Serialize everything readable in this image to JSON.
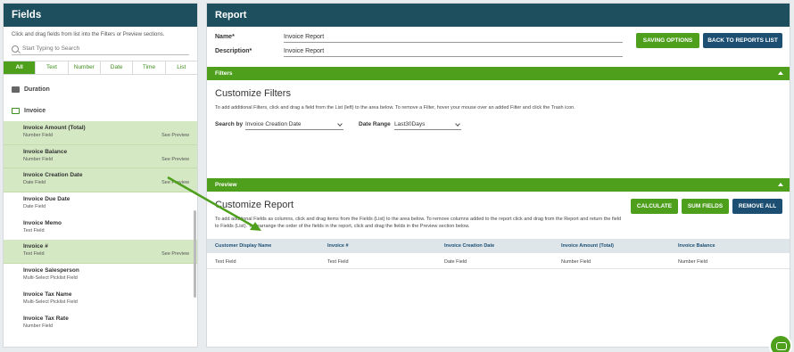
{
  "fields_panel": {
    "title": "Fields",
    "description": "Click and drag fields from list into the Filters or Preview sections.",
    "search_placeholder": "Start Typing to Search",
    "tabs": [
      "All",
      "Text",
      "Number",
      "Date",
      "Time",
      "List"
    ],
    "active_tab": "All",
    "folders": [
      {
        "name": "Duration",
        "state": "closed"
      },
      {
        "name": "Invoice",
        "state": "open"
      }
    ],
    "fields": [
      {
        "name": "Invoice Amount (Total)",
        "type": "Number Field",
        "preview": "See Preview",
        "selected": true
      },
      {
        "name": "Invoice Balance",
        "type": "Number Field",
        "preview": "See Preview",
        "selected": true
      },
      {
        "name": "Invoice Creation Date",
        "type": "Date Field",
        "preview": "See Preview",
        "selected": true
      },
      {
        "name": "Invoice Due Date",
        "type": "Date Field",
        "preview": "",
        "selected": false
      },
      {
        "name": "Invoice Memo",
        "type": "Text Field",
        "preview": "",
        "selected": false
      },
      {
        "name": "Invoice #",
        "type": "Text Field",
        "preview": "See Preview",
        "selected": true
      },
      {
        "name": "Invoice Salesperson",
        "type": "Multi-Select Picklist Field",
        "preview": "",
        "selected": false
      },
      {
        "name": "Invoice Tax Name",
        "type": "Multi-Select Picklist Field",
        "preview": "",
        "selected": false
      },
      {
        "name": "Invoice Tax Rate",
        "type": "Number Field",
        "preview": "",
        "selected": false
      }
    ]
  },
  "report": {
    "title": "Report",
    "name_label": "Name*",
    "name_value": "Invoice Report",
    "description_label": "Description*",
    "description_value": "Invoice Report",
    "saving_options_label": "SAVING OPTIONS",
    "back_label": "BACK TO REPORTS LIST"
  },
  "filters": {
    "bar_label": "Filters",
    "title": "Customize Filters",
    "description": "To add additional Filters, click and drag a field from the List (left) to the area below. To remove a Filter, hover your mouse over an added Filter and click the Trash icon.",
    "search_by_label": "Search by",
    "search_by_value": "Invoice Creation Date",
    "date_range_label": "Date Range",
    "date_range_value": "Last30Days"
  },
  "preview": {
    "bar_label": "Preview",
    "title": "Customize Report",
    "description": "To add additional Fields as columns, click and drag items from the Fields (List) to the area below. To remove columns added to the report click and drag from the Report and return the field to Fields (List). To rearrange the order of the fields in the report, click and drag the fields in the Preview section below.",
    "calculate_label": "CALCULATE",
    "sum_fields_label": "SUM FIELDS",
    "remove_all_label": "REMOVE ALL",
    "columns": [
      "Customer Display Name",
      "Invoice #",
      "Invoice Creation Date",
      "Invoice Amount (Total)",
      "Invoice Balance"
    ],
    "row": [
      "Text Field",
      "Text Field",
      "Date Field",
      "Number Field",
      "Number Field"
    ]
  },
  "colors": {
    "header": "#1d4f5e",
    "green": "#4d9f1c",
    "navy": "#1d4f73",
    "selected_row": "#d4e8c3"
  }
}
